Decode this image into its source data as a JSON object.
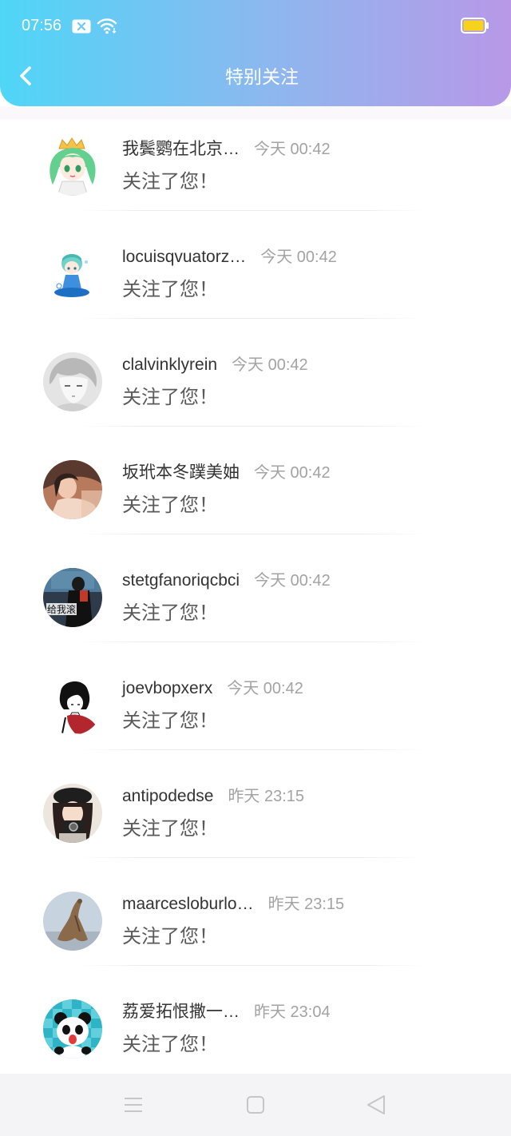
{
  "status_bar": {
    "time": "07:56",
    "icons": [
      "notification-icon",
      "wifi-icon",
      "battery-icon"
    ],
    "battery_fill_color": "#f7d21a"
  },
  "header": {
    "title": "特别关注",
    "back_icon": "chevron-left-icon",
    "gradient_start": "#4fd6f7",
    "gradient_mid": "#8fb6ee",
    "gradient_end": "#b898e8"
  },
  "list": [
    {
      "name": "我鬓鹦在北京…",
      "time": "今天 00:42",
      "action": "关注了您！"
    },
    {
      "name": "locuisqvuatorz…",
      "time": "今天 00:42",
      "action": "关注了您！"
    },
    {
      "name": "clalvinklyrein",
      "time": "今天 00:42",
      "action": "关注了您！"
    },
    {
      "name": "坂玳本冬蹼美妯",
      "time": "今天 00:42",
      "action": "关注了您！"
    },
    {
      "name": "stetgfanoriqcbci",
      "time": "今天 00:42",
      "action": "关注了您！",
      "avatar_text": "给我滚"
    },
    {
      "name": "joevbopxerx",
      "time": "今天 00:42",
      "action": "关注了您！"
    },
    {
      "name": "antipodedse",
      "time": "昨天 23:15",
      "action": "关注了您！"
    },
    {
      "name": "maarcesloburlo…",
      "time": "昨天 23:15",
      "action": "关注了您！"
    },
    {
      "name": "荔爱拓恨撒一…",
      "time": "昨天 23:04",
      "action": "关注了您！"
    }
  ],
  "nav_bar": {
    "icons": [
      "menu-icon",
      "home-square-icon",
      "back-triangle-icon"
    ]
  }
}
